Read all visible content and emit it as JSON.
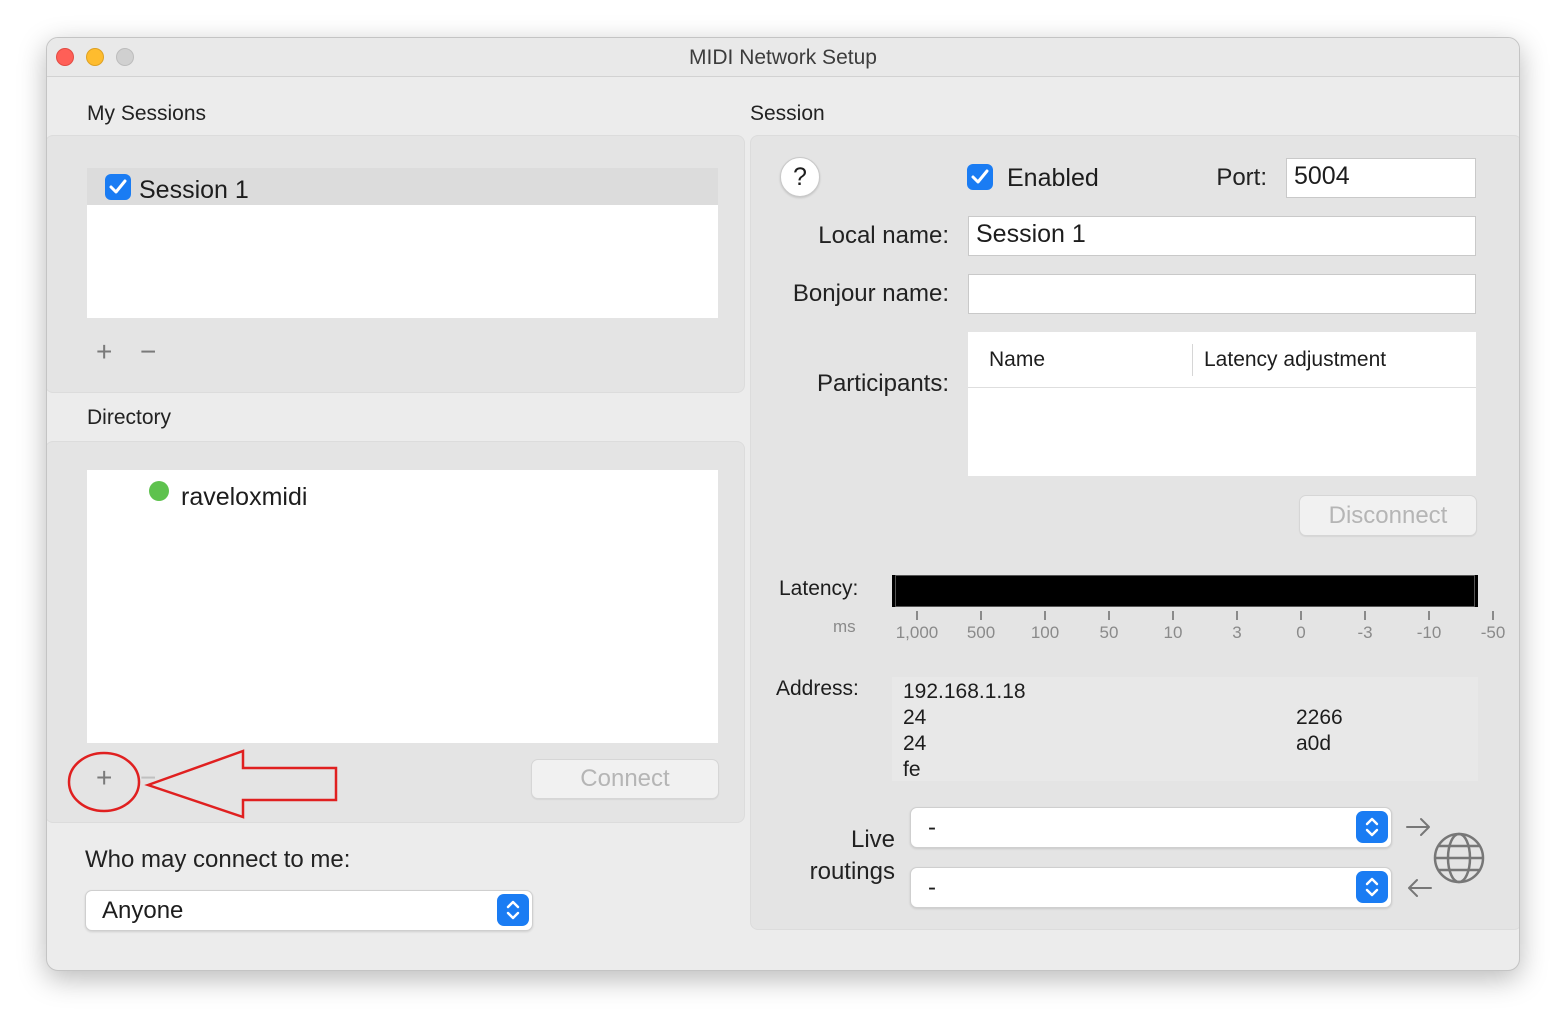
{
  "window": {
    "title": "MIDI Network Setup"
  },
  "my_sessions": {
    "label": "My Sessions",
    "items": [
      {
        "name": "Session 1",
        "checked": true
      }
    ],
    "add_label": "+",
    "remove_label": "−"
  },
  "directory": {
    "label": "Directory",
    "items": [
      {
        "name": "raveloxmidi",
        "status": "online",
        "status_color": "#5ec24e"
      }
    ],
    "add_label": "+",
    "remove_label": "−",
    "connect_label": "Connect"
  },
  "access": {
    "label": "Who may connect to me:",
    "value": "Anyone"
  },
  "session": {
    "label": "Session",
    "help_label": "?",
    "enabled_label": "Enabled",
    "enabled": true,
    "port_label": "Port:",
    "port_value": "5004",
    "local_name_label": "Local name:",
    "local_name_value": "Session 1",
    "bonjour_name_label": "Bonjour name:",
    "bonjour_name_value": "",
    "participants_label": "Participants:",
    "participants_columns": [
      "Name",
      "Latency adjustment"
    ],
    "disconnect_label": "Disconnect",
    "latency_label": "Latency:",
    "latency_unit": "ms",
    "latency_ticks": [
      "1,000",
      "500",
      "100",
      "50",
      "10",
      "3",
      "0",
      "-3",
      "-10",
      "-50"
    ],
    "address_label": "Address:",
    "address_lines": [
      "192.168.1.18",
      "24",
      "2266",
      "24",
      "a0d",
      "fe"
    ],
    "live_routings_label_1": "Live",
    "live_routings_label_2": "routings",
    "routing_out_value": "-",
    "routing_in_value": "-"
  },
  "annotation": {
    "color": "#e02020"
  },
  "colors": {
    "accent": "#1a7cf3",
    "close": "#ff5f57",
    "minimize": "#febc2e",
    "zoom_inactive": "#d0d0d0"
  }
}
